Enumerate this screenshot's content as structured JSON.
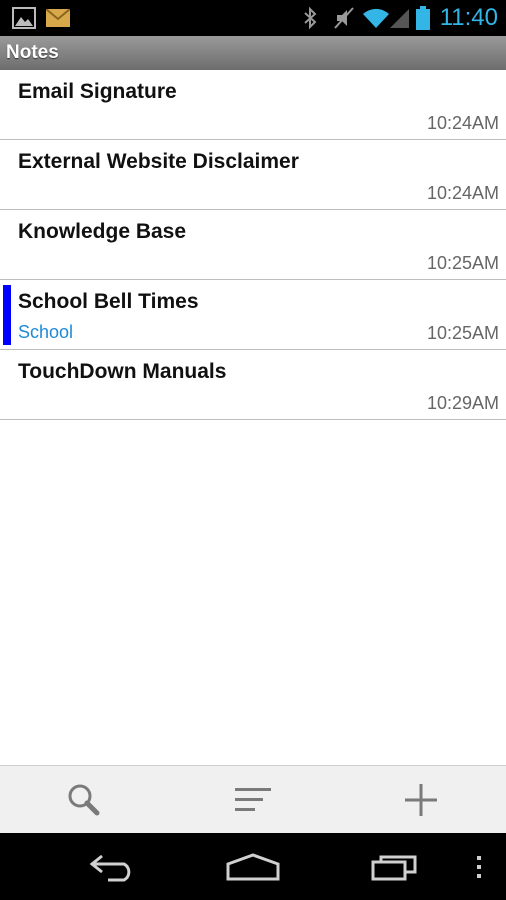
{
  "status_bar": {
    "time": "11:40"
  },
  "title_bar": {
    "title": "Notes"
  },
  "notes": [
    {
      "title": "Email Signature",
      "category": "",
      "time": "10:24AM"
    },
    {
      "title": "External Website Disclaimer",
      "category": "",
      "time": "10:24AM"
    },
    {
      "title": "Knowledge Base",
      "category": "",
      "time": "10:25AM"
    },
    {
      "title": "School Bell Times",
      "category": "School",
      "time": "10:25AM"
    },
    {
      "title": "TouchDown Manuals",
      "category": "",
      "time": "10:29AM"
    }
  ],
  "colors": {
    "accent": "#33b5e5",
    "category_marker": "#0000ff",
    "category_text": "#1e8ad6"
  },
  "bottom_bar": {
    "icons": [
      "search-icon",
      "sort-icon",
      "add-icon"
    ]
  },
  "nav_bar": {
    "icons": [
      "back-icon",
      "home-icon",
      "recent-apps-icon",
      "overflow-menu-icon"
    ]
  }
}
